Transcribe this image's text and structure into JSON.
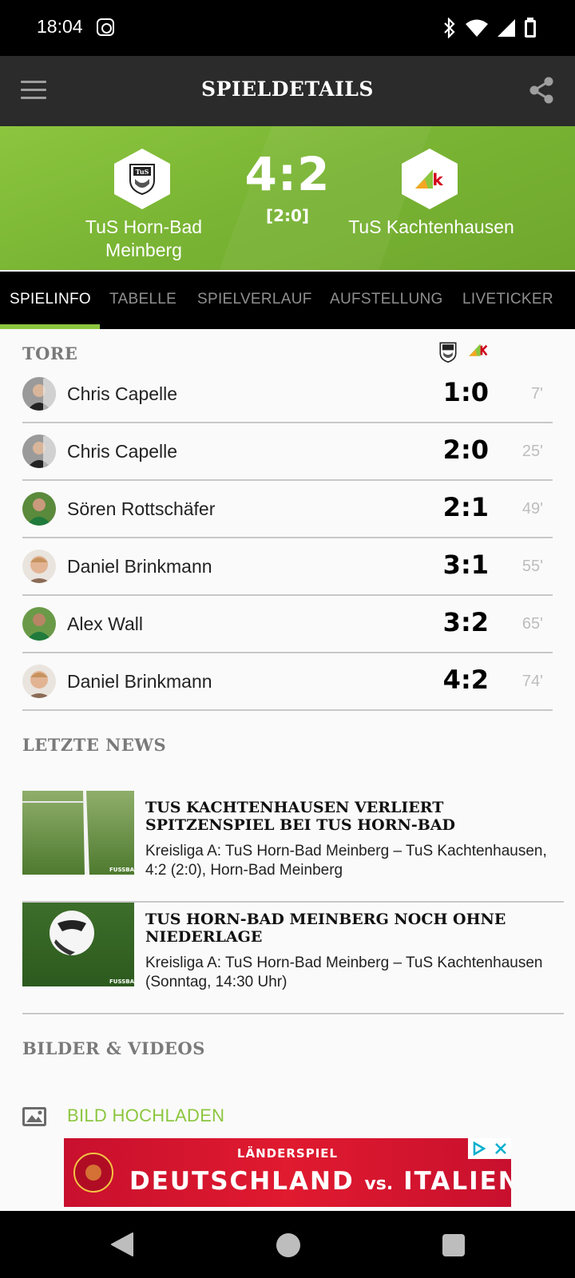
{
  "status_bar": {
    "time": "18:04"
  },
  "app_bar": {
    "title": "SPIELDETAILS"
  },
  "match": {
    "home_team": "TuS Horn-Bad Meinberg",
    "away_team": "TuS Kachtenhausen",
    "score": "4:2",
    "halftime": "[2:0]",
    "home_badge_text": "TuS",
    "away_badge_text": "k"
  },
  "tabs": [
    "SPIELINFO",
    "TABELLE",
    "SPIELVERLAUF",
    "AUFSTELLUNG",
    "LIVETICKER"
  ],
  "goals": {
    "title": "TORE",
    "items": [
      {
        "player": "Chris Capelle",
        "score": "1:0",
        "minute": "7'"
      },
      {
        "player": "Chris Capelle",
        "score": "2:0",
        "minute": "25'"
      },
      {
        "player": "Sören Rottschäfer",
        "score": "2:1",
        "minute": "49'"
      },
      {
        "player": "Daniel Brinkmann",
        "score": "3:1",
        "minute": "55'"
      },
      {
        "player": "Alex Wall",
        "score": "3:2",
        "minute": "65'"
      },
      {
        "player": "Daniel Brinkmann",
        "score": "4:2",
        "minute": "74'"
      }
    ]
  },
  "news": {
    "title": "LETZTE NEWS",
    "items": [
      {
        "headline": "TUS KACHTENHAUSEN VERLIERT SPITZENSPIEL BEI TUS HORN-BAD",
        "meta": "Kreisliga A: TuS Horn-Bad Meinberg – TuS Kachtenhausen, 4:2 (2:0), Horn-Bad Meinberg",
        "thumb_brand": "FUSSBA"
      },
      {
        "headline": "TUS HORN-BAD MEINBERG NOCH OHNE NIEDERLAGE",
        "meta": "Kreisliga A: TuS Horn-Bad Meinberg – TuS Kachtenhausen (Sonntag, 14:30 Uhr)",
        "thumb_brand": "FUSSBA"
      }
    ]
  },
  "media": {
    "title": "BILDER & VIDEOS",
    "upload_label": "BILD HOCHLADEN"
  },
  "ad": {
    "kicker": "LÄNDERSPIEL",
    "team_a": "DEUTSCHLAND",
    "vs": "vs.",
    "team_b": "ITALIEN"
  },
  "colors": {
    "accent": "#8cc63f",
    "header_bg": "#2b2b2b",
    "ad_red": "#d5122a"
  }
}
